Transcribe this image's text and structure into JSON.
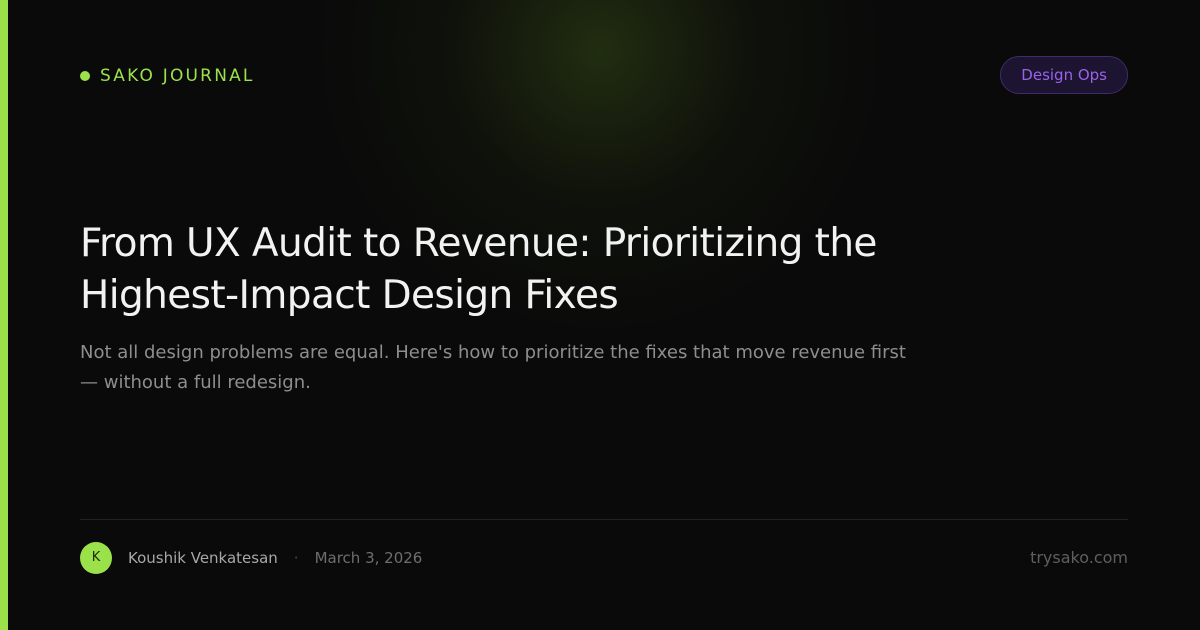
{
  "brand": {
    "name": "SAKO JOURNAL",
    "dot_icon": "green-dot-icon",
    "accent_color": "#9be24a"
  },
  "tag": {
    "label": "Design Ops",
    "color": "#9a63ea"
  },
  "article": {
    "title": "From UX Audit to Revenue: Prioritizing the Highest-Impact Design Fixes",
    "subtitle": "Not all design problems are equal. Here's how to prioritize the fixes that move revenue first — without a full redesign."
  },
  "meta": {
    "avatar_initial": "K",
    "author": "Koushik Venkatesan",
    "separator": "·",
    "date": "March 3, 2026"
  },
  "footer": {
    "site": "trysako.com"
  },
  "colors": {
    "background": "#0a0a0a",
    "accent": "#9be24a",
    "tag_text": "#9a63ea",
    "title_text": "#f2f2f2",
    "body_text": "#8e8e8e"
  }
}
